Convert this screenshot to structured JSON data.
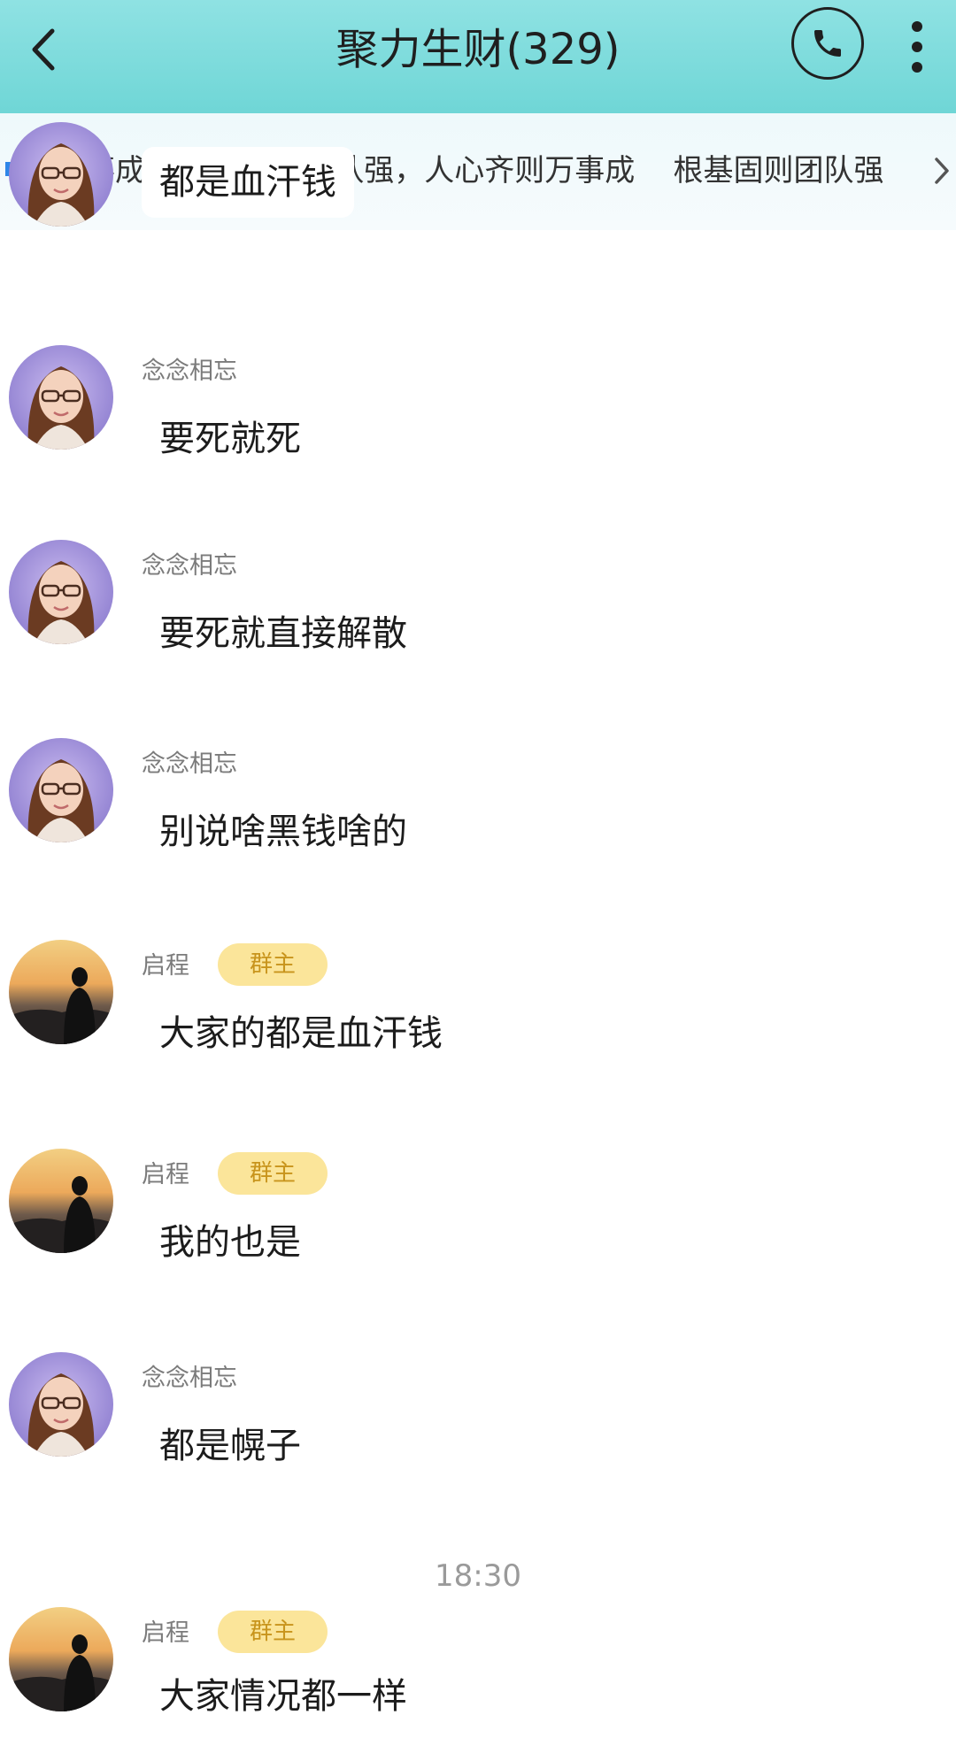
{
  "header": {
    "title": "聚力生财(329)"
  },
  "announcement": {
    "text": "万事成    根基固则团队强，人心齐则万事成    根基固则团队强"
  },
  "messages": [
    {
      "sender": "",
      "role": "",
      "text": "都是血汗钱",
      "avatar": "girl-avatar"
    },
    {
      "sender": "念念相忘",
      "role": "",
      "text": "要死就死",
      "avatar": "girl-avatar"
    },
    {
      "sender": "念念相忘",
      "role": "",
      "text": "要死就直接解散",
      "avatar": "girl-avatar"
    },
    {
      "sender": "念念相忘",
      "role": "",
      "text": "别说啥黑钱啥的",
      "avatar": "girl-avatar"
    },
    {
      "sender": "启程",
      "role": "群主",
      "text": "大家的都是血汗钱",
      "avatar": "sunset-silhouette-avatar"
    },
    {
      "sender": "启程",
      "role": "群主",
      "text": "我的也是",
      "avatar": "sunset-silhouette-avatar"
    },
    {
      "sender": "念念相忘",
      "role": "",
      "text": "都是幌子",
      "avatar": "girl-avatar"
    },
    {
      "sender": "启程",
      "role": "群主",
      "text": "大家情况都一样",
      "avatar": "sunset-silhouette-avatar"
    }
  ],
  "timestamp": "18:30",
  "colors": {
    "header_bg": "#7ddcdc",
    "owner_badge_bg": "#fbe59a",
    "owner_badge_text": "#c8941c",
    "speaker_icon": "#2d86e8"
  },
  "icons": [
    "back-icon",
    "phone-icon",
    "more-icon",
    "speaker-icon",
    "chevron-right-icon"
  ]
}
